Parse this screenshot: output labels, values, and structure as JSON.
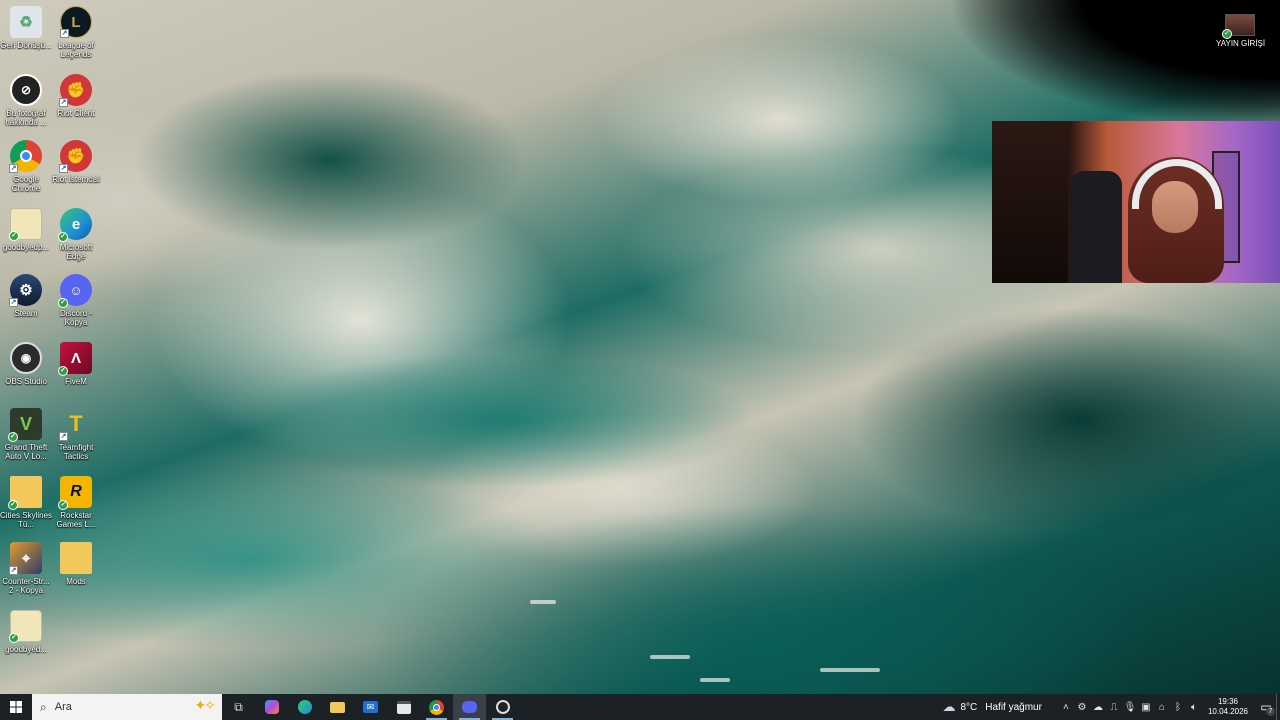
{
  "desktop_icons": [
    {
      "id": "recycle",
      "label": "Geri Dönüşü...",
      "icon": "recycle-bin-icon",
      "color": "#cfd6dd"
    },
    {
      "id": "lol",
      "label": "League of Legends",
      "icon": "league-of-legends-icon",
      "color": "#c8a24b"
    },
    {
      "id": "photo",
      "label": "Bu fotoğraf hakkında ...",
      "icon": "camera-info-icon",
      "color": "#2b2b2b"
    },
    {
      "id": "riot1",
      "label": "Riot Client",
      "icon": "riot-client-icon",
      "color": "#d13639"
    },
    {
      "id": "chrome",
      "label": "Google Chrome",
      "icon": "chrome-icon",
      "color": "#ffffff"
    },
    {
      "id": "riot2",
      "label": "Riot İstemcisi",
      "icon": "riot-client-icon",
      "color": "#d13639"
    },
    {
      "id": "gbfile1",
      "label": "goodbyedp...",
      "icon": "file-icon",
      "color": "#f1e6b8"
    },
    {
      "id": "edge",
      "label": "Microsoft Edge",
      "icon": "edge-icon",
      "color": "#1f8fd4"
    },
    {
      "id": "steam",
      "label": "Steam",
      "icon": "steam-icon",
      "color": "#1b2a44"
    },
    {
      "id": "discord",
      "label": "Discord - Kopya",
      "icon": "discord-icon",
      "color": "#5865f2"
    },
    {
      "id": "obs",
      "label": "OBS Studio",
      "icon": "obs-icon",
      "color": "#2b2b2b"
    },
    {
      "id": "fiveM",
      "label": "FiveM",
      "icon": "fivem-icon",
      "color": "#c8103e"
    },
    {
      "id": "gta",
      "label": "Grand Theft Auto V Lo...",
      "icon": "gta-icon",
      "color": "#4d8b3a"
    },
    {
      "id": "tft",
      "label": "Teamfight Tactics",
      "icon": "teamfight-tactics-icon",
      "color": "#e8c21a"
    },
    {
      "id": "cities",
      "label": "Cities Skylines Tü...",
      "icon": "folder-icon",
      "color": "#f2c75c"
    },
    {
      "id": "rockstar",
      "label": "Rockstar Games L...",
      "icon": "rockstar-icon",
      "color": "#f4b400"
    },
    {
      "id": "cs2",
      "label": "Counter-Str... 2 - Kopya",
      "icon": "counter-strike-icon",
      "color": "#e39b2c"
    },
    {
      "id": "mods",
      "label": "Mods",
      "icon": "folder-icon",
      "color": "#f2c75c"
    },
    {
      "id": "gbfile2",
      "label": "goodbyed...",
      "icon": "file-icon",
      "color": "#f1e6b8"
    }
  ],
  "stream_shortcut": {
    "label": "YAYIN GİRİŞİ",
    "icon": "stream-image-icon"
  },
  "taskbar": {
    "search_placeholder": "Ara",
    "apps": [
      {
        "name": "task-view",
        "icon": "task-view-icon"
      },
      {
        "name": "copilot",
        "icon": "copilot-icon"
      },
      {
        "name": "edge",
        "icon": "edge-icon"
      },
      {
        "name": "file-explorer",
        "icon": "folder-icon"
      },
      {
        "name": "mail",
        "icon": "mail-icon"
      },
      {
        "name": "store",
        "icon": "store-icon"
      },
      {
        "name": "chrome",
        "icon": "chrome-icon"
      },
      {
        "name": "discord",
        "icon": "discord-icon"
      },
      {
        "name": "obs",
        "icon": "obs-icon"
      }
    ],
    "weather": {
      "temp": "8°C",
      "condition": "Hafif yağmur"
    },
    "clock": {
      "time": "19:36",
      "date": "10.04.2026"
    },
    "notification_count": "7"
  }
}
